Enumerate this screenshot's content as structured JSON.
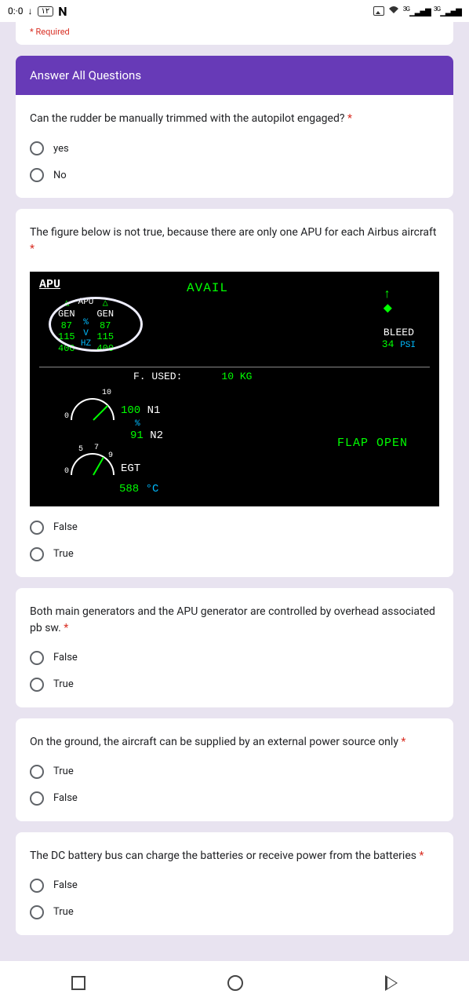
{
  "status": {
    "time_left": "0:·0",
    "down_icon": "↓",
    "key_label": "١٢",
    "n": "N",
    "sig_label": "3G"
  },
  "required_text": "* Required",
  "section_title": "Answer All Questions",
  "q1": {
    "text": "Can the rudder be manually trimmed with the autopilot engaged? ",
    "req": "*",
    "opt1": "yes",
    "opt2": "No"
  },
  "q2": {
    "text": "The figure below is not true, because there are only one APU for each Airbus aircraft ",
    "req": "*",
    "opt1": "False",
    "opt2": "True"
  },
  "apu": {
    "title": "APU",
    "avail": "AVAIL",
    "apu_label": "APU",
    "gen": "GEN",
    "pct87": "87",
    "v115": "115",
    "hz400": "400",
    "pct": "%",
    "v": "V",
    "hz": "HZ",
    "bleed": "BLEED",
    "bleed_val": "34",
    "psi": "PSI",
    "fused": "F. USED:",
    "fused_val": "10 KG",
    "ten": "10",
    "zero": "0",
    "n1_val": "100",
    "n1": "N1",
    "pct_sym": "%",
    "n2_val": "91",
    "n2": "N2",
    "flap": "FLAP OPEN",
    "five": "5",
    "seven": "7",
    "nine": "9",
    "egt": "EGT",
    "egt_val": "588",
    "degc": "°C"
  },
  "q3": {
    "text": "Both main generators and the APU generator are controlled by overhead associated pb sw. ",
    "req": "*",
    "opt1": "False",
    "opt2": "True"
  },
  "q4": {
    "text": "On the ground, the aircraft can be supplied by an external power source only ",
    "req": "*",
    "opt1": "True",
    "opt2": "False"
  },
  "q5": {
    "text": "The DC battery bus can charge the batteries or receive power from the batteries ",
    "req": "*",
    "opt1": "False",
    "opt2": "True"
  }
}
